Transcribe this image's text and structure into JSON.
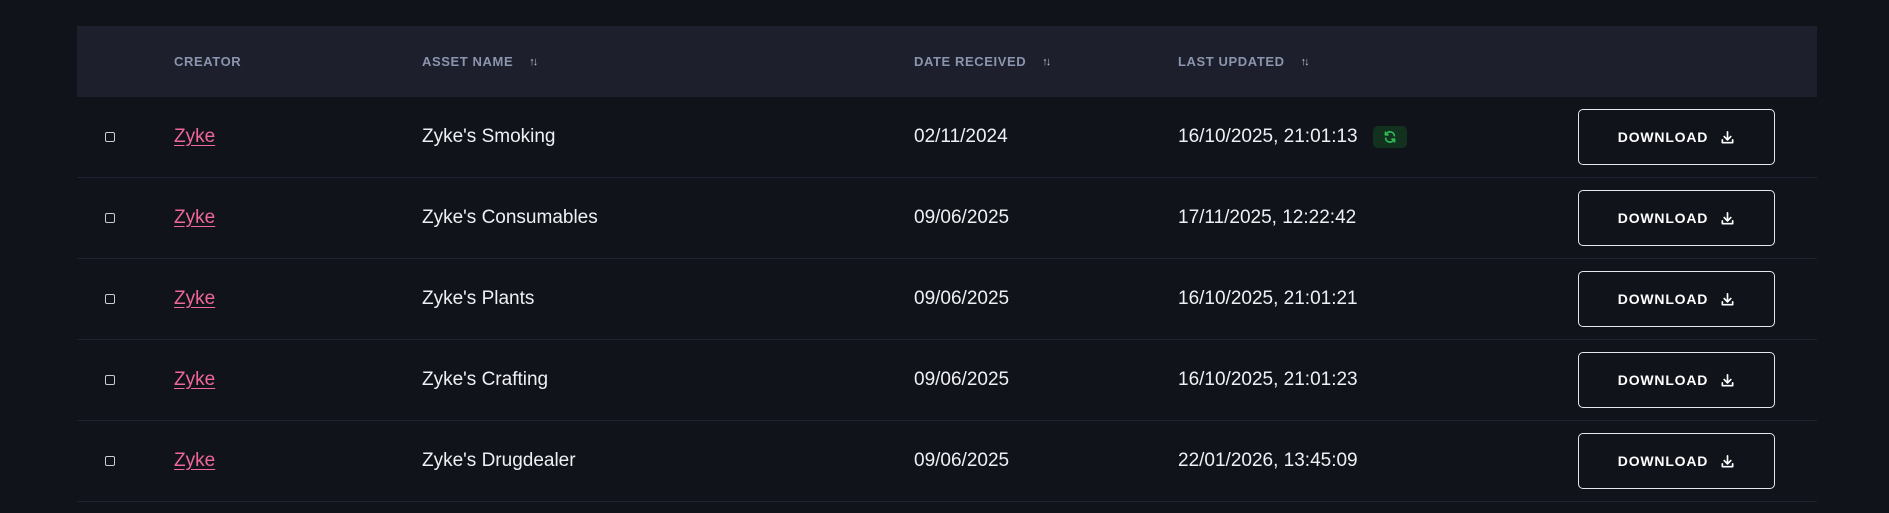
{
  "table": {
    "columns": {
      "creator": "CREATOR",
      "asset_name": "ASSET NAME",
      "date_received": "DATE RECEIVED",
      "last_updated": "LAST UPDATED"
    },
    "sort_icon": "sort-arrows-icon",
    "download_label": "DOWNLOAD",
    "rows": [
      {
        "creator": "Zyke",
        "asset_name": "Zyke's Smoking",
        "date_received": "02/11/2024",
        "last_updated": "16/10/2025, 21:01:13",
        "sync_badge": true
      },
      {
        "creator": "Zyke",
        "asset_name": "Zyke's Consumables",
        "date_received": "09/06/2025",
        "last_updated": "17/11/2025, 12:22:42",
        "sync_badge": false
      },
      {
        "creator": "Zyke",
        "asset_name": "Zyke's Plants",
        "date_received": "09/06/2025",
        "last_updated": "16/10/2025, 21:01:21",
        "sync_badge": false
      },
      {
        "creator": "Zyke",
        "asset_name": "Zyke's Crafting",
        "date_received": "09/06/2025",
        "last_updated": "16/10/2025, 21:01:23",
        "sync_badge": false
      },
      {
        "creator": "Zyke",
        "asset_name": "Zyke's Drugdealer",
        "date_received": "09/06/2025",
        "last_updated": "22/01/2026, 13:45:09",
        "sync_badge": false
      }
    ]
  },
  "colors": {
    "background": "#11131b",
    "header_bg": "#1d202c",
    "creator_link": "#f0679a",
    "sync_badge_bg": "#12321f",
    "sync_icon": "#2fbf5a"
  }
}
